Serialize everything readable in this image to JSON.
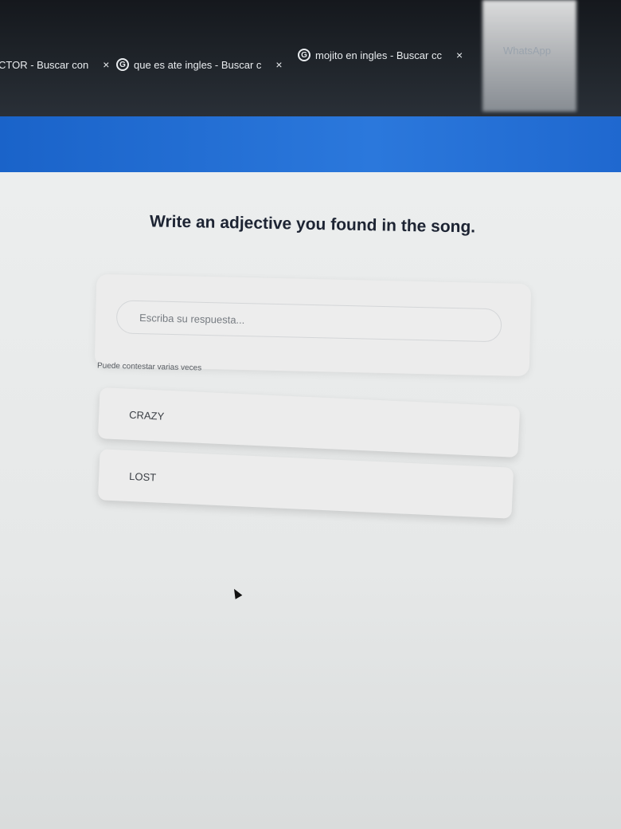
{
  "browser": {
    "tabs": [
      {
        "label": "CTOR - Buscar con",
        "close": "×"
      },
      {
        "icon": "G",
        "label": "que es ate ingles - Buscar c",
        "close": "×"
      },
      {
        "icon": "G",
        "label": "mojito en ingles - Buscar cc",
        "close": "×"
      },
      {
        "label": "WhatsApp"
      }
    ]
  },
  "question": {
    "title": "Write an adjective you found in the song.",
    "input_placeholder": "Escriba su respuesta...",
    "hint": "Puede contestar varias veces"
  },
  "answers": [
    "CRAZY",
    "LOST"
  ],
  "colors": {
    "header_blue": "#2b78dc",
    "tab_bar": "#1b1f24",
    "title_text": "#1d2433"
  }
}
